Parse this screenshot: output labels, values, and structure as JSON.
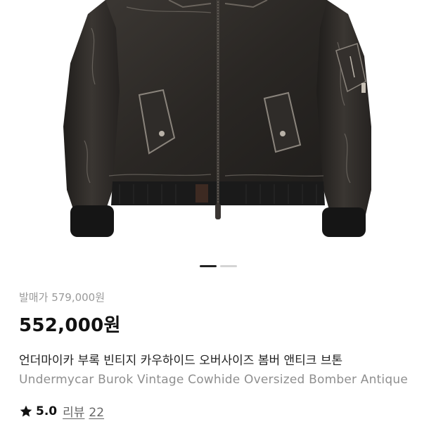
{
  "product": {
    "original_price_label": "발매가",
    "original_price": "579,000원",
    "price": "552,000원",
    "name_ko": "언더마이카 부록 빈티지 카우하이드 오버사이즈 봄버 앤티크 브톤",
    "name_en": "Undermycar Burok Vintage Cowhide Oversized Bomber Antique"
  },
  "gallery": {
    "image_name": "leather-bomber-jacket-photo",
    "current_slide": 1,
    "total_slides": 2
  },
  "rating": {
    "icon": "star-icon",
    "score": "5.0",
    "review_label": "리뷰",
    "review_count": "22"
  },
  "colors": {
    "price": "#111111",
    "muted": "#9a9a9a",
    "jacket": "#2e2b28"
  }
}
